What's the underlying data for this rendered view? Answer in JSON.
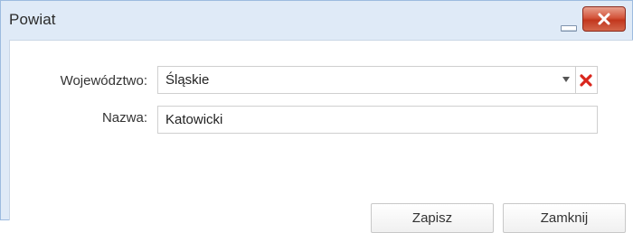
{
  "window": {
    "title": "Powiat",
    "minimize_icon": "minimize-icon",
    "close_icon": "close-icon",
    "close_color": "#c9462b"
  },
  "form": {
    "wojewodztwo_label": "Województwo:",
    "wojewodztwo_value": "Śląskie",
    "clear_icon": "red-x-icon",
    "nazwa_label": "Nazwa:",
    "nazwa_value": "Katowicki"
  },
  "buttons": {
    "save": "Zapisz",
    "cancel": "Zamknij"
  }
}
